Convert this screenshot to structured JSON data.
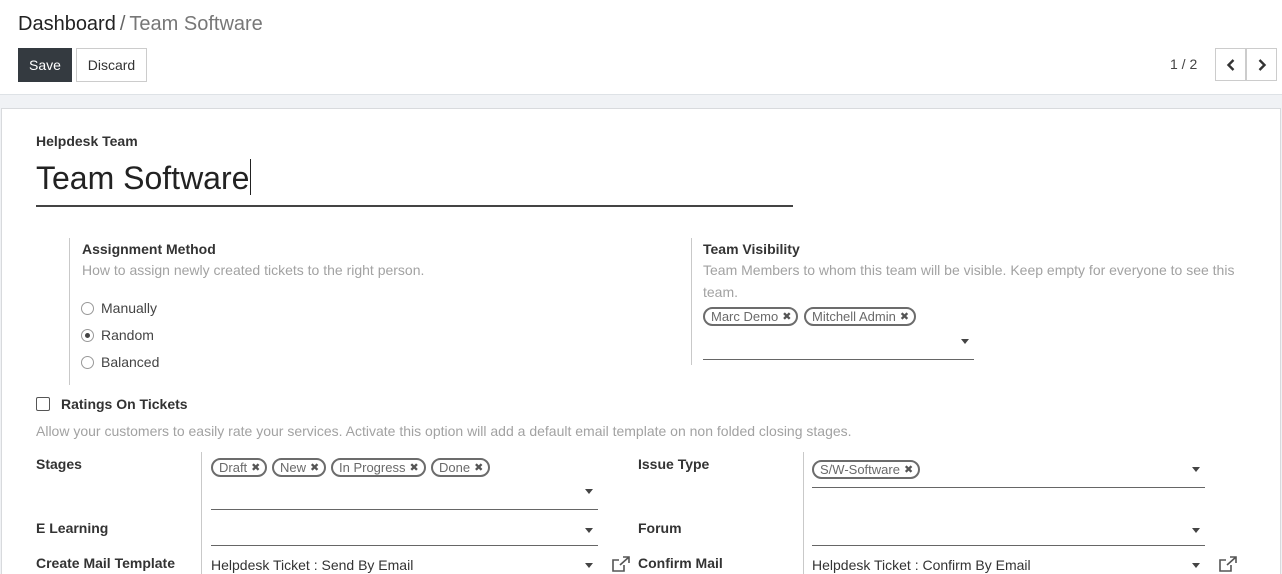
{
  "breadcrumb": {
    "parent": "Dashboard",
    "separator": "/",
    "current": "Team Software"
  },
  "toolbar": {
    "save_label": "Save",
    "discard_label": "Discard"
  },
  "pager": {
    "value": "1 / 2"
  },
  "form": {
    "team_label": "Helpdesk Team",
    "team_name": "Team Software",
    "assignment": {
      "label": "Assignment Method",
      "help": "How to assign newly created tickets to the right person.",
      "options": [
        "Manually",
        "Random",
        "Balanced"
      ],
      "selected": "Random"
    },
    "visibility": {
      "label": "Team Visibility",
      "help": "Team Members to whom this team will be visible. Keep empty for everyone to see this team.",
      "tags": [
        "Marc Demo",
        "Mitchell Admin"
      ]
    },
    "ratings": {
      "label": "Ratings On Tickets",
      "checked": false,
      "help": "Allow your customers to easily rate your services. Activate this option will add a default email template on non folded closing stages."
    },
    "stages": {
      "label": "Stages",
      "tags": [
        "Draft",
        "New",
        "In Progress",
        "Done"
      ]
    },
    "issue_type": {
      "label": "Issue Type",
      "tags": [
        "S/W-Software"
      ]
    },
    "elearning": {
      "label": "E Learning",
      "value": ""
    },
    "forum": {
      "label": "Forum",
      "value": ""
    },
    "create_mail_template": {
      "label": "Create Mail Template",
      "value": "Helpdesk Ticket : Send By Email"
    },
    "confirm_mail": {
      "label": "Confirm Mail",
      "value": "Helpdesk Ticket : Confirm By Email"
    }
  },
  "icons": {
    "remove_tag": "✖",
    "prev": "chevron-left-icon",
    "next": "chevron-right-icon",
    "external": "external-link-icon",
    "dropdown": "caret-down-icon"
  }
}
